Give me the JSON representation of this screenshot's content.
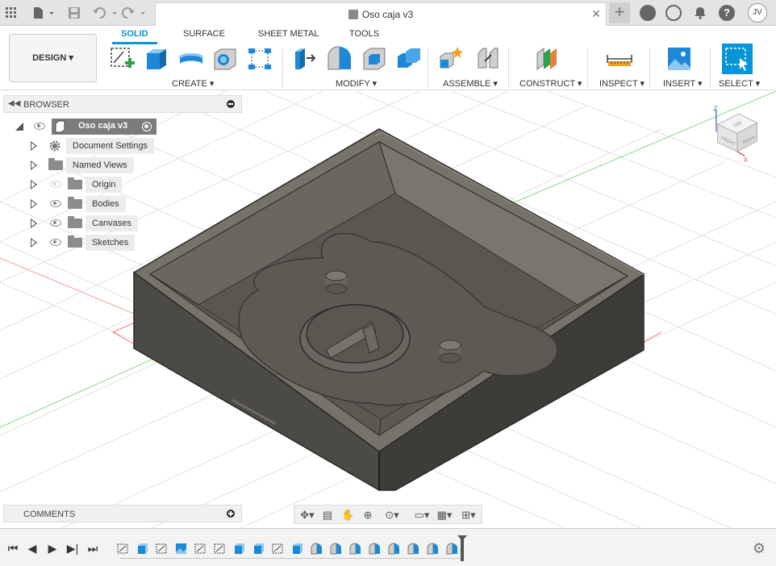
{
  "window": {
    "doc_title": "Oso caja v3",
    "user_initials": "JV"
  },
  "ribbon": {
    "workspace": "DESIGN ▾",
    "tabs": [
      "SOLID",
      "SURFACE",
      "SHEET METAL",
      "TOOLS"
    ],
    "active_tab": "SOLID",
    "groups": [
      "CREATE ▾",
      "MODIFY ▾",
      "ASSEMBLE ▾",
      "CONSTRUCT ▾",
      "INSPECT ▾",
      "INSERT ▾",
      "SELECT ▾"
    ]
  },
  "browser": {
    "title": "BROWSER",
    "root": "Oso caja v3",
    "items": [
      {
        "label": "Document Settings",
        "icon": "gear-icon",
        "visible": null
      },
      {
        "label": "Named Views",
        "icon": "folder-icon",
        "visible": null
      },
      {
        "label": "Origin",
        "icon": "folder-icon",
        "visible": false
      },
      {
        "label": "Bodies",
        "icon": "folder-icon",
        "visible": true
      },
      {
        "label": "Canvases",
        "icon": "folder-icon",
        "visible": true
      },
      {
        "label": "Sketches",
        "icon": "folder-icon",
        "visible": true
      }
    ]
  },
  "comments": {
    "title": "COMMENTS"
  },
  "viewcube": {
    "faces": [
      "TOP",
      "FRONT",
      "RIGHT"
    ],
    "axes": [
      "Z",
      "X"
    ]
  },
  "colors": {
    "accent": "#0696d7",
    "model": "#5a5750",
    "grid": "#d8d8d8"
  }
}
